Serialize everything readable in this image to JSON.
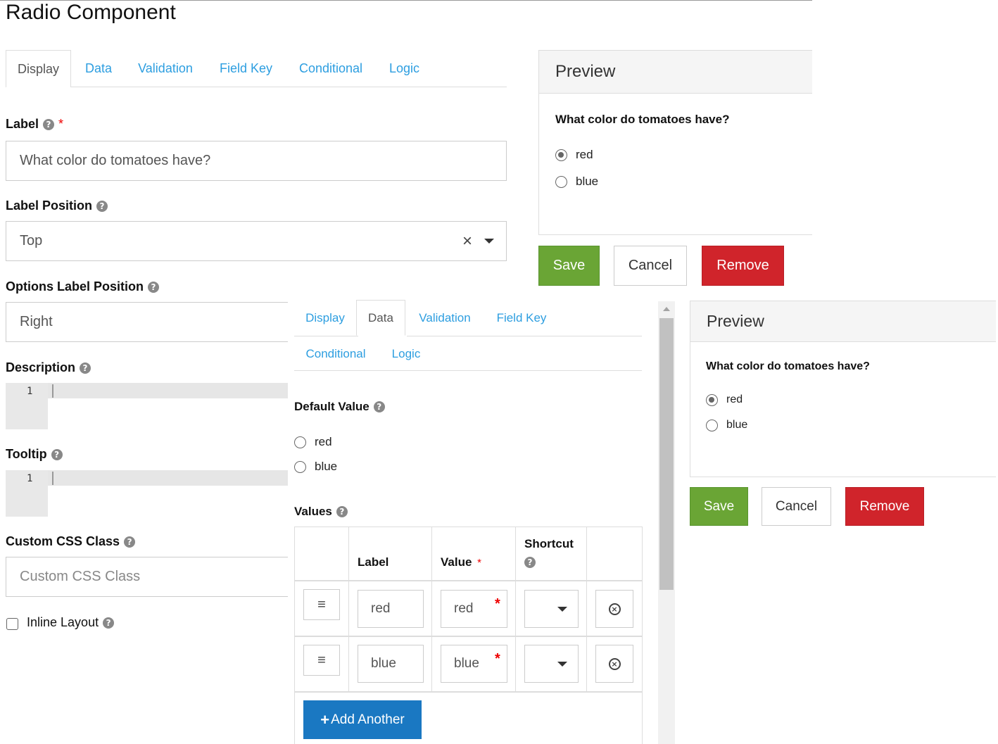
{
  "page": {
    "title": "Radio Component"
  },
  "editor_left": {
    "tabs": [
      "Display",
      "Data",
      "Validation",
      "Field Key",
      "Conditional",
      "Logic"
    ],
    "active_tab": "Display",
    "label": {
      "label": "Label",
      "value": "What color do tomatoes have?",
      "required_mark": "*"
    },
    "label_position": {
      "label": "Label Position",
      "value": "Top",
      "clear_glyph": "×"
    },
    "options_label_position": {
      "label": "Options Label Position",
      "value": "Right"
    },
    "description": {
      "label": "Description",
      "line_number": "1"
    },
    "tooltip": {
      "label": "Tooltip",
      "line_number": "1"
    },
    "custom_css_class": {
      "label": "Custom CSS Class",
      "placeholder": "Custom CSS Class"
    },
    "inline_layout": {
      "label": "Inline Layout",
      "checked": false
    },
    "help_glyph": "?"
  },
  "preview_top": {
    "title": "Preview",
    "question": "What color do tomatoes have?",
    "options": [
      {
        "label": "red",
        "checked": true
      },
      {
        "label": "blue",
        "checked": false
      }
    ],
    "buttons": {
      "save": "Save",
      "cancel": "Cancel",
      "remove": "Remove"
    }
  },
  "editor_data": {
    "tabs": [
      "Display",
      "Data",
      "Validation",
      "Field Key",
      "Conditional",
      "Logic"
    ],
    "active_tab": "Data",
    "default_value": {
      "label": "Default Value",
      "options": [
        {
          "label": "red",
          "checked": false
        },
        {
          "label": "blue",
          "checked": false
        }
      ]
    },
    "values": {
      "label": "Values",
      "columns": {
        "label": "Label",
        "value": "Value",
        "shortcut": "Shortcut",
        "required_mark": "*"
      },
      "rows": [
        {
          "label": "red",
          "value": "red"
        },
        {
          "label": "blue",
          "value": "blue"
        }
      ],
      "drag_glyph": "≡",
      "remove_glyph": "×",
      "add_button": {
        "icon": "+",
        "label": "Add Another"
      }
    }
  },
  "preview_bottom": {
    "title": "Preview",
    "question": "What color do tomatoes have?",
    "options": [
      {
        "label": "red",
        "checked": true
      },
      {
        "label": "blue",
        "checked": false
      }
    ],
    "buttons": {
      "save": "Save",
      "cancel": "Cancel",
      "remove": "Remove"
    }
  },
  "colors": {
    "link": "#2d9ee0",
    "save": "#6aa535",
    "remove": "#d0242b",
    "primary": "#1a78c2",
    "required": "#ee0000"
  }
}
